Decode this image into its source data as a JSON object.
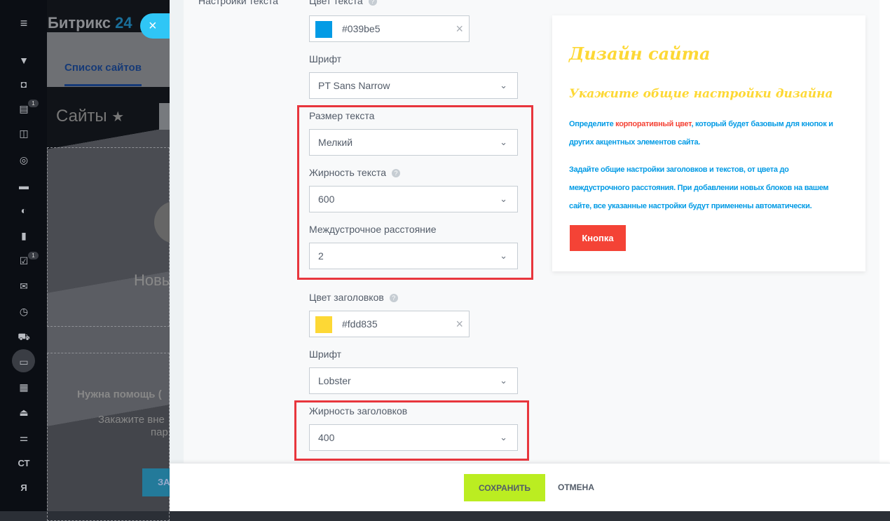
{
  "app": {
    "logo_text": "Битрикс",
    "logo_num": "24",
    "close_icon": "×"
  },
  "background": {
    "tab": "Список сайтов",
    "title": "Сайты",
    "star": "★",
    "card1_text": "Новы",
    "card2_line1": "Нужна помощь (",
    "card2_line2": "Закажите вне",
    "card2_line3": "пар",
    "card2_button": "ЗА"
  },
  "sidebar": {
    "badges": [
      "1",
      "1"
    ],
    "initials": "СТ",
    "user": "Я"
  },
  "form": {
    "section_label": "Настройки текста",
    "text_color": {
      "label": "Цвет текста",
      "value": "#039be5",
      "swatch": "#039be5"
    },
    "text_font": {
      "label": "Шрифт",
      "value": "PT Sans Narrow"
    },
    "text_size": {
      "label": "Размер текста",
      "value": "Мелкий"
    },
    "text_weight": {
      "label": "Жирность текста",
      "value": "600"
    },
    "line_height": {
      "label": "Междустрочное расстояние",
      "value": "2"
    },
    "heading_color": {
      "label": "Цвет заголовков",
      "value": "#fdd835",
      "swatch": "#fdd835"
    },
    "heading_font": {
      "label": "Шрифт",
      "value": "Lobster"
    },
    "heading_weight": {
      "label": "Жирность заголовков",
      "value": "400"
    },
    "help": "?",
    "clear": "×",
    "chevron": "⌄"
  },
  "preview": {
    "title": "Дизайн сайта",
    "subtitle": "Укажите общие настройки дизайна",
    "p1_before": "Определите ",
    "p1_accent": "корпоративный цвет",
    "p1_after": ", который будет базовым для кнопок и других акцентных элементов сайта.",
    "p2": "Задайте общие настройки заголовков и текстов, от цвета до междустрочного расстояния. При добавлении новых блоков на вашем сайте, все указанные настройки будут применены автоматически.",
    "button": "Кнопка",
    "colors": {
      "heading": "#fdd835",
      "text": "#039be5",
      "accent": "#f44336"
    }
  },
  "footer": {
    "save": "СОХРАНИТЬ",
    "cancel": "ОТМЕНА"
  }
}
